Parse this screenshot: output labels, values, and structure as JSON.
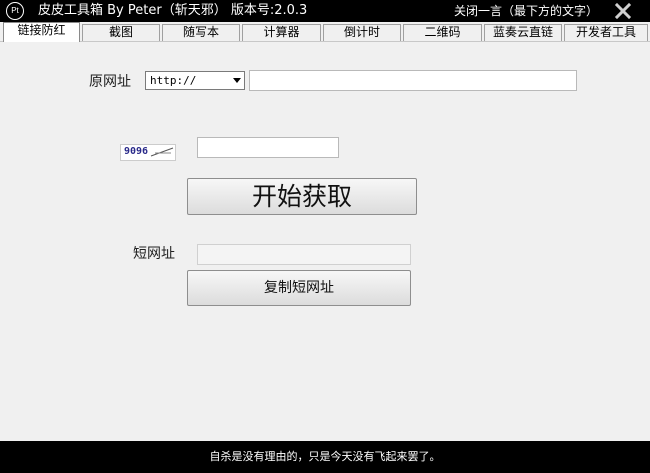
{
  "titlebar": {
    "logo_text": "Pt",
    "title": "皮皮工具箱 By Peter（斩天邪）  版本号:2.0.3",
    "close_quote_label": "关闭一言（最下方的文字）"
  },
  "tabs": [
    {
      "label": "链接防红",
      "active": true
    },
    {
      "label": "截图",
      "active": false
    },
    {
      "label": "随写本",
      "active": false
    },
    {
      "label": "计算器",
      "active": false
    },
    {
      "label": "倒计时",
      "active": false
    },
    {
      "label": "二维码",
      "active": false
    },
    {
      "label": "蓝奏云直链",
      "active": false
    },
    {
      "label": "开发者工具",
      "active": false
    }
  ],
  "form": {
    "original_url_label": "原网址",
    "protocol_selected": "http://",
    "original_url_value": "",
    "captcha_text": "9096",
    "captcha_input_value": "",
    "start_button_label": "开始获取",
    "short_url_label": "短网址",
    "short_url_value": "",
    "copy_button_label": "复制短网址"
  },
  "footer": {
    "quote": "自杀是没有理由的，只是今天没有飞起来罢了。"
  }
}
